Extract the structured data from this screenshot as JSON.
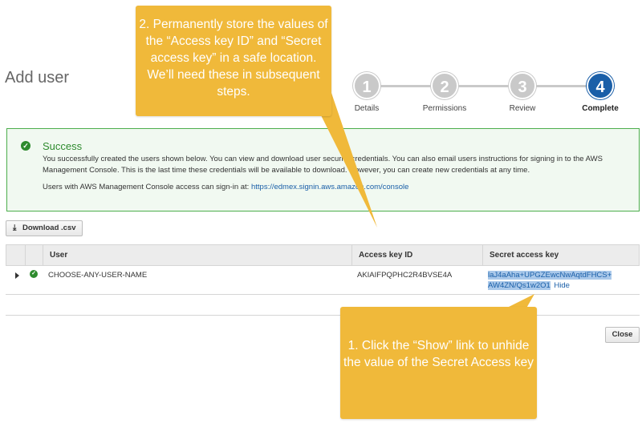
{
  "page": {
    "title": "Add user"
  },
  "steps": [
    {
      "number": "1",
      "label": "Details"
    },
    {
      "number": "2",
      "label": "Permissions"
    },
    {
      "number": "3",
      "label": "Review"
    },
    {
      "number": "4",
      "label": "Complete"
    }
  ],
  "active_step": "Complete",
  "alert": {
    "title": "Success",
    "message": "You successfully created the users shown below. You can view and download user security credentials. You can also email users instructions for signing in to the AWS Management Console. This is the last time these credentials will be available to download. However, you can create new credentials at any time.",
    "console_prefix": "Users with AWS Management Console access can sign-in at: ",
    "console_url": "https://edmex.signin.aws.amazon.com/console"
  },
  "toolbar": {
    "download_label": "Download .csv"
  },
  "table": {
    "headers": {
      "user": "User",
      "access_key_id": "Access key ID",
      "secret_access_key": "Secret access key"
    },
    "rows": [
      {
        "user": "CHOOSE-ANY-USER-NAME",
        "access_key_id": "AKIAIFPQPHC2R4BVSE4A",
        "secret_access_key": "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",
        "hide_label": "Hide"
      }
    ]
  },
  "footer": {
    "close_label": "Close"
  },
  "callouts": {
    "top": "2. Permanently store the values of the “Access key ID” and “Secret access key” in a safe location. We’ll need these in subsequent steps.",
    "bottom": "1. Click the “Show” link to unhide the value of the Secret Access key"
  },
  "colors": {
    "accent": "#1a5fa8",
    "success": "#2e8b2e",
    "callout": "#f0b93a"
  }
}
